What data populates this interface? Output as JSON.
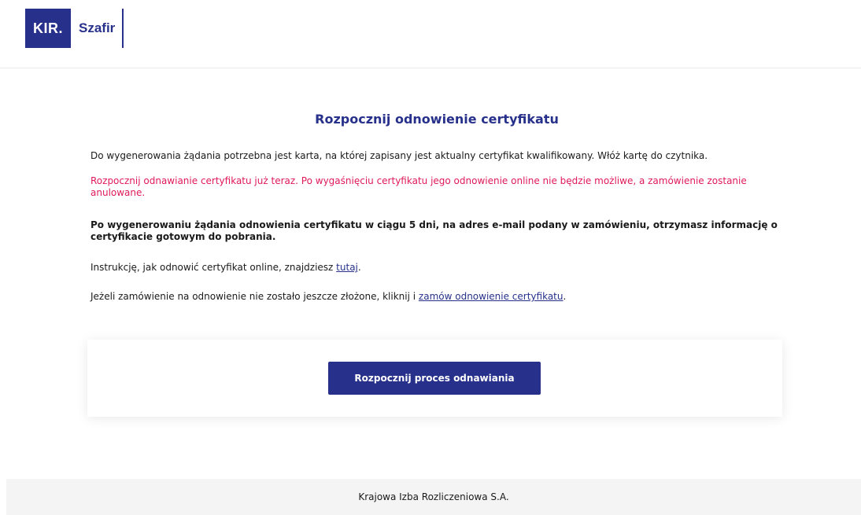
{
  "header": {
    "logo_kir": "KIR.",
    "logo_product": "Szafir"
  },
  "main": {
    "title": "Rozpocznij odnowienie certyfikatu",
    "info_text": "Do wygenerowania żądania potrzebna jest karta, na której zapisany jest aktualny certyfikat kwalifikowany. Włóż kartę do czytnika.",
    "warning_text": "Rozpocznij odnawianie certyfikatu już teraz. Po wygaśnięciu certyfikatu jego odnowienie online nie będzie możliwe, a zamówienie zostanie anulowane.",
    "bold_text": "Po wygenerowaniu żądania odnowienia certyfikatu w ciągu 5 dni, na adres e-mail podany w zamówieniu, otrzymasz informację o certyfikacie gotowym do pobrania.",
    "instruction_prefix": "Instrukcję, jak odnowić certyfikat online, znajdziesz ",
    "instruction_link": "tutaj",
    "instruction_suffix": ".",
    "order_prefix": "Jeżeli zamówienie na odnowienie nie zostało jeszcze złożone, kliknij i ",
    "order_link": "zamów odnowienie certyfikatu",
    "order_suffix": "."
  },
  "action": {
    "start_button_label": "Rozpocznij proces odnawiania"
  },
  "footer": {
    "text": "Krajowa Izba Rozliczeniowa S.A."
  },
  "colors": {
    "brand": "#27318b",
    "warning": "#e0195a"
  }
}
